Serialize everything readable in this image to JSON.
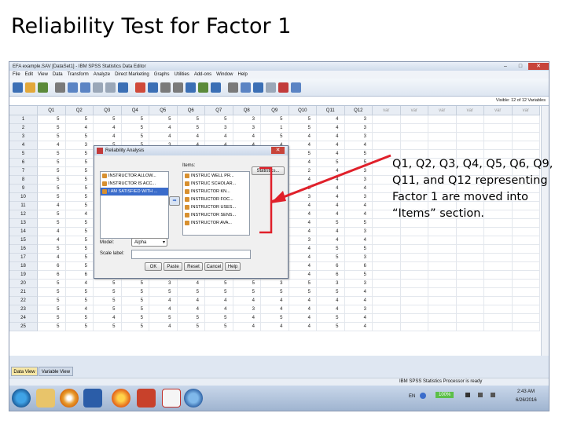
{
  "slide_title": "Reliability Test for Factor 1",
  "window": {
    "title": "EFA example.SAV [DataSet1] - IBM SPSS Statistics Data Editor",
    "minimize": "–",
    "maximize": "□",
    "close": "✕",
    "menu": [
      "File",
      "Edit",
      "View",
      "Data",
      "Transform",
      "Analyze",
      "Direct Marketing",
      "Graphs",
      "Utilities",
      "Add-ons",
      "Window",
      "Help"
    ],
    "visible_label": "Visible: 12 of 12 Variables",
    "columns": [
      "Q1",
      "Q2",
      "Q3",
      "Q4",
      "Q5",
      "Q6",
      "Q7",
      "Q8",
      "Q9",
      "Q10",
      "Q11",
      "Q12",
      "var",
      "var",
      "var",
      "var",
      "var",
      "var"
    ],
    "rows": [
      {
        "n": "1",
        "v": [
          "5",
          "5",
          "5",
          "5",
          "5",
          "5",
          "5",
          "3",
          "5",
          "5",
          "4",
          "3"
        ]
      },
      {
        "n": "2",
        "v": [
          "5",
          "4",
          "4",
          "5",
          "4",
          "5",
          "3",
          "3",
          "1",
          "5",
          "4",
          "3"
        ]
      },
      {
        "n": "3",
        "v": [
          "5",
          "5",
          "4",
          "5",
          "4",
          "4",
          "4",
          "4",
          "5",
          "4",
          "4",
          "3"
        ]
      },
      {
        "n": "4",
        "v": [
          "4",
          "3",
          "5",
          "5",
          "3",
          "4",
          "4",
          "4",
          "4",
          "4",
          "4",
          "4"
        ]
      },
      {
        "n": "5",
        "v": [
          "5",
          "5",
          "5",
          "5",
          "5",
          "5",
          "5",
          "5",
          "5",
          "5",
          "4",
          "5"
        ]
      },
      {
        "n": "6",
        "v": [
          "5",
          "5",
          "5",
          "5",
          "5",
          "5",
          "5",
          "4",
          "5",
          "4",
          "5",
          "5"
        ]
      },
      {
        "n": "7",
        "v": [
          "5",
          "5",
          "5",
          "5",
          "5",
          "5",
          "5",
          "4",
          "4",
          "2",
          "4",
          "3"
        ]
      },
      {
        "n": "8",
        "v": [
          "5",
          "5",
          "5",
          "5",
          "5",
          "5",
          "5",
          "5",
          "4",
          "4",
          "4",
          "3"
        ]
      },
      {
        "n": "9",
        "v": [
          "5",
          "5",
          "5",
          "5",
          "5",
          "5",
          "5",
          "5",
          "5",
          "3",
          "4",
          "4"
        ]
      },
      {
        "n": "10",
        "v": [
          "5",
          "5",
          "5",
          "5",
          "5",
          "5",
          "5",
          "4",
          "4",
          "3",
          "4",
          "3"
        ]
      },
      {
        "n": "11",
        "v": [
          "4",
          "5",
          "5",
          "5",
          "5",
          "5",
          "5",
          "4",
          "4",
          "4",
          "4",
          "4"
        ]
      },
      {
        "n": "12",
        "v": [
          "5",
          "4",
          "5",
          "5",
          "5",
          "5",
          "5",
          "5",
          "5",
          "4",
          "4",
          "4"
        ]
      },
      {
        "n": "13",
        "v": [
          "5",
          "5",
          "5",
          "5",
          "5",
          "5",
          "5",
          "5",
          "5",
          "4",
          "5",
          "5"
        ]
      },
      {
        "n": "14",
        "v": [
          "4",
          "5",
          "5",
          "5",
          "5",
          "5",
          "5",
          "5",
          "5",
          "4",
          "4",
          "3"
        ]
      },
      {
        "n": "15",
        "v": [
          "4",
          "5",
          "5",
          "5",
          "5",
          "5",
          "5",
          "4",
          "4",
          "3",
          "4",
          "4"
        ]
      },
      {
        "n": "16",
        "v": [
          "5",
          "5",
          "5",
          "5",
          "5",
          "5",
          "5",
          "4",
          "4",
          "4",
          "5",
          "5"
        ]
      },
      {
        "n": "17",
        "v": [
          "4",
          "5",
          "5",
          "5",
          "5",
          "5",
          "5",
          "4",
          "4",
          "4",
          "5",
          "3"
        ]
      },
      {
        "n": "18",
        "v": [
          "6",
          "5",
          "6",
          "5",
          "5",
          "5",
          "5",
          "5",
          "5",
          "4",
          "6",
          "6"
        ]
      },
      {
        "n": "19",
        "v": [
          "6",
          "6",
          "6",
          "5",
          "6",
          "5",
          "5",
          "5",
          "4",
          "4",
          "6",
          "5"
        ]
      },
      {
        "n": "20",
        "v": [
          "5",
          "4",
          "5",
          "5",
          "3",
          "4",
          "5",
          "5",
          "3",
          "5",
          "3",
          "3"
        ]
      },
      {
        "n": "21",
        "v": [
          "5",
          "5",
          "5",
          "5",
          "5",
          "5",
          "5",
          "5",
          "5",
          "5",
          "5",
          "4"
        ]
      },
      {
        "n": "22",
        "v": [
          "5",
          "5",
          "5",
          "5",
          "4",
          "4",
          "4",
          "4",
          "4",
          "4",
          "4",
          "4"
        ]
      },
      {
        "n": "23",
        "v": [
          "5",
          "4",
          "5",
          "5",
          "4",
          "4",
          "4",
          "3",
          "4",
          "4",
          "4",
          "3"
        ]
      },
      {
        "n": "24",
        "v": [
          "5",
          "5",
          "4",
          "5",
          "5",
          "5",
          "5",
          "4",
          "5",
          "4",
          "5",
          "4"
        ]
      },
      {
        "n": "25",
        "v": [
          "5",
          "5",
          "5",
          "5",
          "4",
          "5",
          "5",
          "4",
          "4",
          "4",
          "5",
          "4"
        ]
      }
    ],
    "tabs": {
      "data_view": "Data View",
      "variable_view": "Variable View"
    },
    "status": "IBM SPSS Statistics Processor is ready",
    "tray": {
      "lang": "EN",
      "battery": "100%",
      "time": "2:43 AM",
      "date": "6/26/2016"
    }
  },
  "dialog": {
    "title": "Reliability Analysis",
    "close": "✕",
    "left_items": [
      "INSTRUCTOR ALLOW...",
      "INSTRUCTOR IS ACC...",
      "I AM SATISFIED WITH ..."
    ],
    "items_label": "Items:",
    "items": [
      "INSTRUC WELL PR...",
      "INSTRUC SCHOLAR...",
      "INSTRUCTOR KN...",
      "INSTRUCTOR FOC...",
      "INSTRUCTOR USES...",
      "INSTRUCTOR SENS...",
      "INSTRUCTOR AVA..."
    ],
    "statistics_button": "Statistics...",
    "model_label": "Model:",
    "model_value": "Alpha",
    "scale_label": "Scale label:",
    "buttons": [
      "OK",
      "Paste",
      "Reset",
      "Cancel",
      "Help"
    ]
  },
  "annotation": "Q1, Q2, Q3, Q4, Q5, Q6, Q9, Q11, and Q12 representing Factor 1 are moved into “Items” section.",
  "colors": {
    "arrow": "#e0202a",
    "selection": "#3a6ccb",
    "active_tab": "#f7e7a6"
  }
}
